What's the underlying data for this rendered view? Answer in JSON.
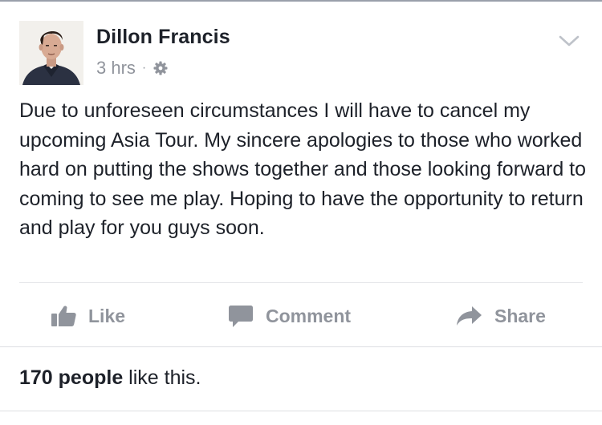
{
  "post": {
    "author": "Dillon Francis",
    "timestamp": "3 hrs",
    "separator": "·",
    "privacy_icon": "gear-icon",
    "options_icon": "chevron-down-icon",
    "text": "Due to unforeseen circumstances I will have to cancel my upcoming Asia Tour. My sincere apologies to those who worked hard on putting the shows together and those looking forward to coming to see me play. Hoping to have the opportunity to return and play for you guys soon."
  },
  "actions": {
    "like_label": "Like",
    "comment_label": "Comment",
    "share_label": "Share"
  },
  "reactions": {
    "count_text": "170 people",
    "suffix": " like this."
  },
  "colors": {
    "text": "#1d2129",
    "muted": "#90949c",
    "divider": "#e5e6e9"
  }
}
